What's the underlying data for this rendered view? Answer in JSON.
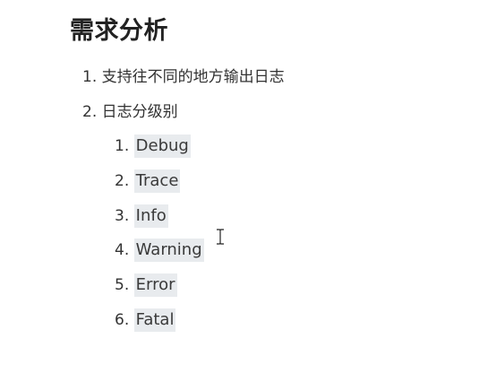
{
  "heading": "需求分析",
  "items": [
    {
      "num": "1.",
      "text": "支持往不同的地方输出日志"
    },
    {
      "num": "2.",
      "text": "日志分级别"
    }
  ],
  "levels": [
    {
      "num": "1.",
      "text": "Debug"
    },
    {
      "num": "2.",
      "text": "Trace"
    },
    {
      "num": "3.",
      "text": "Info"
    },
    {
      "num": "4.",
      "text": "Warning"
    },
    {
      "num": "5.",
      "text": "Error"
    },
    {
      "num": "6.",
      "text": "Fatal"
    }
  ],
  "cursor_icon": "text-cursor-icon"
}
